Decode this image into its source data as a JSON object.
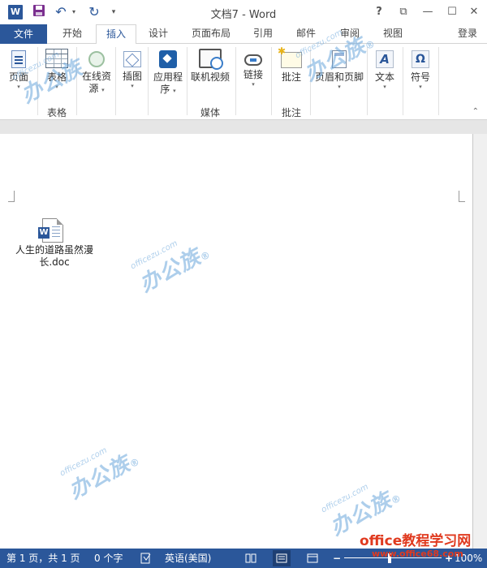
{
  "window": {
    "title": "文档7 - Word",
    "app_icon_letter": "W",
    "quick_access": {
      "save_icon": "floppy-disk-icon",
      "undo_glyph": "↶",
      "undo_dropdown_glyph": "▾",
      "redo_glyph": "↻",
      "customize_glyph": "▾"
    },
    "controls": {
      "help": "?",
      "ribbon_options": "⧉",
      "minimize": "—",
      "maximize": "☐",
      "close": "✕"
    }
  },
  "tabs": [
    {
      "label": "文件",
      "key": "file"
    },
    {
      "label": "开始",
      "key": "home"
    },
    {
      "label": "插入",
      "key": "insert",
      "active": true
    },
    {
      "label": "设计",
      "key": "design"
    },
    {
      "label": "页面布局",
      "key": "layout"
    },
    {
      "label": "引用",
      "key": "references"
    },
    {
      "label": "邮件",
      "key": "mailings"
    },
    {
      "label": "审阅",
      "key": "review"
    },
    {
      "label": "视图",
      "key": "view"
    }
  ],
  "login_label": "登录",
  "ribbon": {
    "buttons": {
      "pages": {
        "label": "页面",
        "icon": "page-icon"
      },
      "table": {
        "label": "表格",
        "icon": "table-icon"
      },
      "online_resources": {
        "label_line1": "在线资",
        "label_line2": "源",
        "icon": "online-resources-icon"
      },
      "illustrations": {
        "label": "插图",
        "icon": "illustrations-icon"
      },
      "apps": {
        "label_line1": "应用程",
        "label_line2": "序",
        "icon": "apps-icon"
      },
      "online_video": {
        "label": "联机视频",
        "icon": "online-video-icon"
      },
      "links": {
        "label": "链接",
        "icon": "link-icon"
      },
      "comment": {
        "label": "批注",
        "icon": "comment-icon"
      },
      "header_footer": {
        "label": "页眉和页脚",
        "icon": "header-footer-icon"
      },
      "text": {
        "label": "文本",
        "icon_glyph": "A"
      },
      "symbols": {
        "label": "符号",
        "icon_glyph": "Ω"
      }
    },
    "dropdown_glyph": "▾",
    "groups": {
      "tables": "表格",
      "media": "媒体",
      "comments": "批注"
    },
    "collapse_glyph": "⌃"
  },
  "document": {
    "embedded_file": {
      "icon_letter": "W",
      "name_line1": "人生的道路虽然漫",
      "name_line2": "长.doc"
    }
  },
  "watermark": {
    "site_small": "officezu.com",
    "site_big": "办公族",
    "registered": "®",
    "corner_title": "office教程学习网",
    "corner_url": "www.office68.com"
  },
  "statusbar": {
    "pages": "第 1 页，共 1 页",
    "words": "0 个字",
    "proofing_icon": "proofing-icon",
    "language": "英语(美国)",
    "zoom_minus": "−",
    "zoom_plus": "+",
    "zoom_level": "100%",
    "zoom_fraction": 0.47
  },
  "colors": {
    "accent": "#2b579a",
    "watermark": "#6ba7dc",
    "site_mark": "#e03a1f"
  }
}
